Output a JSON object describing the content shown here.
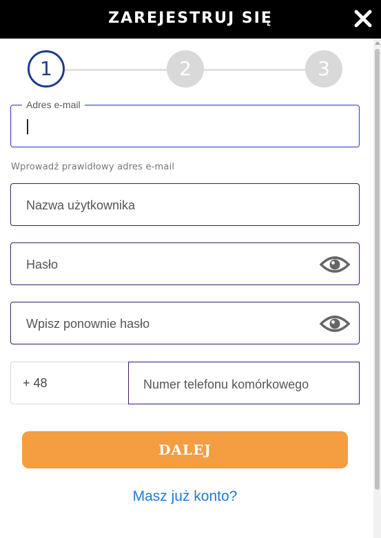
{
  "header": {
    "title": "ZAREJESTRUJ SIĘ",
    "close_icon": "close-icon"
  },
  "stepper": {
    "current_step": 1,
    "steps": [
      {
        "label": "1",
        "state": "active"
      },
      {
        "label": "2",
        "state": "inactive"
      },
      {
        "label": "3",
        "state": "inactive"
      }
    ]
  },
  "form": {
    "email": {
      "label": "Adres e-mail",
      "value": "",
      "hint": "Wprowadź prawidłowy adres e-mail"
    },
    "username": {
      "placeholder": "Nazwa użytkownika"
    },
    "password": {
      "placeholder": "Hasło",
      "icon": "eye-icon"
    },
    "password_repeat": {
      "placeholder": "Wpisz ponownie hasło",
      "icon": "eye-icon"
    },
    "phone": {
      "prefix": "+ 48",
      "placeholder": "Numer telefonu komórkowego"
    }
  },
  "actions": {
    "submit_label": "DALEJ",
    "login_link": "Masz już konto?"
  },
  "colors": {
    "header_bg": "#000000",
    "accent_orange": "#f49d41",
    "step_active": "#1e3a8a",
    "field_border": "#3d1766",
    "link_blue": "#1f7ad6"
  }
}
